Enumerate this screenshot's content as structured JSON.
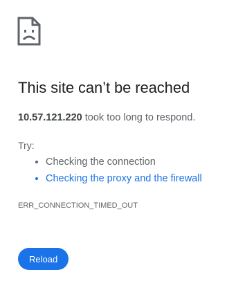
{
  "icon": "sad-document-icon",
  "title": "This site can’t be reached",
  "summary": {
    "host": "10.57.121.220",
    "message": " took too long to respond."
  },
  "try_label": "Try:",
  "suggestions": [
    {
      "label": "Checking the connection",
      "is_link": false
    },
    {
      "label": "Checking the proxy and the firewall",
      "is_link": true
    }
  ],
  "error_code": "ERR_CONNECTION_TIMED_OUT",
  "reload_label": "Reload",
  "colors": {
    "accent": "#1a73e8",
    "title": "#202124",
    "body": "#5f6368"
  }
}
